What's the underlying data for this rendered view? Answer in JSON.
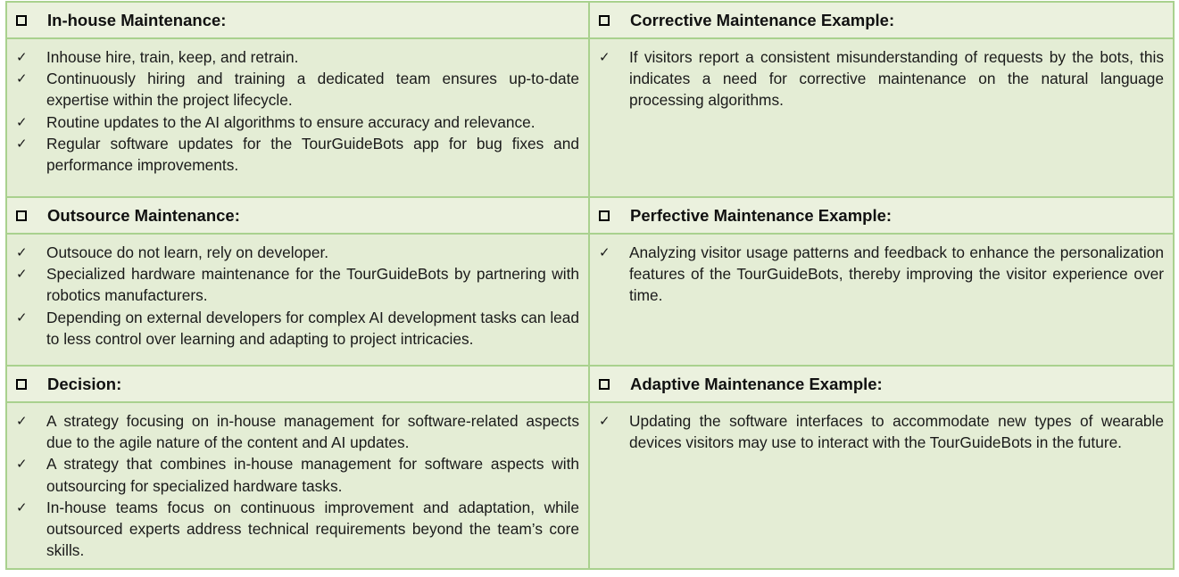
{
  "sections": [
    {
      "title": "In-house Maintenance:",
      "items": [
        "Inhouse hire, train, keep, and retrain.",
        "Continuously hiring and training a dedicated team ensures up-to-date expertise within the project lifecycle.",
        "Routine updates to the AI algorithms to ensure accuracy and relevance.",
        "Regular software updates for the TourGuideBots app for bug fixes and performance improvements."
      ]
    },
    {
      "title": "Corrective Maintenance Example:",
      "items": [
        "If visitors report a consistent misunderstanding of requests by the bots, this indicates a need for corrective maintenance on the natural language processing algorithms."
      ]
    },
    {
      "title": "Outsource Maintenance:",
      "items": [
        "Outsouce do not learn, rely on developer.",
        "Specialized hardware maintenance for the TourGuideBots by partnering with robotics manufacturers.",
        "Depending on external developers for complex AI development tasks can lead to less control over learning and adapting to project intricacies."
      ]
    },
    {
      "title": "Perfective Maintenance Example:",
      "items": [
        "Analyzing visitor usage patterns and feedback to enhance the personalization features of the TourGuideBots, thereby improving the visitor experience over time."
      ]
    },
    {
      "title": "Decision:",
      "items": [
        "A strategy focusing on in-house management for software-related aspects due to the agile nature of the content and AI updates.",
        "A strategy that combines in-house management for software aspects with outsourcing for specialized hardware tasks.",
        "In-house teams focus on continuous improvement and adaptation, while outsourced experts address technical requirements beyond the team’s core skills."
      ]
    },
    {
      "title": "Adaptive Maintenance Example:",
      "items": [
        "Updating the software interfaces to accommodate new types of wearable devices visitors may use to interact with the TourGuideBots in the future."
      ]
    }
  ],
  "bullet_glyph": "✓",
  "colors": {
    "header_bg": "#ebf1de",
    "body_bg": "#e4edd5",
    "border": "#a9d18e"
  }
}
